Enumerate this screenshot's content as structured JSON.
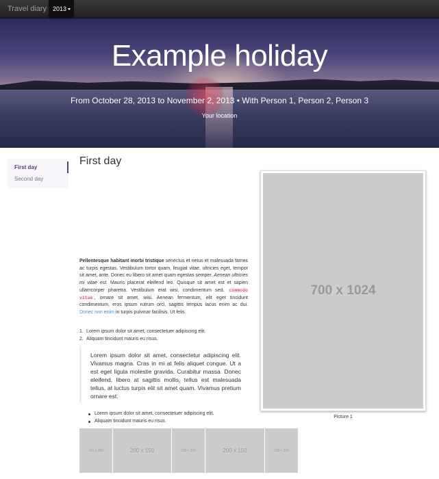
{
  "navbar": {
    "brand": "Travel diary",
    "year": "2013"
  },
  "hero": {
    "title": "Example holiday",
    "dates": "From October 28, 2013 to November 2, 2013 • With Person 1, Person 2, Person 3",
    "location": "Your location"
  },
  "sidebar": {
    "items": [
      {
        "label": "First day",
        "active": true
      },
      {
        "label": "Second day",
        "active": false
      }
    ]
  },
  "main": {
    "day_title": "First day",
    "big_picture": {
      "placeholder": "700 x 1024",
      "caption": "Picture 1"
    },
    "lead": {
      "bold": "Pellentesque habitant morbi tristique",
      "text1": " senectus et netus et malesuada fames ac turpis egestas. Vestibulum tortor quam, feugiat vitae, ultricies eget, tempor sit amet, ante. Donec eu libero sit amet quam egestas semper. ",
      "italic": "Aenean ultricies mi vitae est.",
      "text2": " Mauris placerat eleifend leo. Quisque sit amet est et sapien ullamcorper pharetra. Vestibulum erat wisi, condimentum sed, ",
      "code": "commodo vitae",
      "text3": ", ornare sit amet, wisi. Aenean fermentum, elit eget tincidunt condimentum, eros ipsum rutrum orci, sagittis tempus lacus enim ac dui. ",
      "link": "Donec non enim",
      "text4": " in turpis pulvinar facilisis. Ut felis."
    },
    "ordered_list": [
      {
        "num": "1.",
        "text": "Lorem ipsum dolor sit amet, consectetuer adipiscing elit."
      },
      {
        "num": "2.",
        "text": "Aliquam tincidunt mauris eu risus."
      }
    ],
    "blockquote": "Lorem ipsum dolor sit amet, consectetur adipiscing elit. Vivamus magna. Cras in mi at felis aliquet congue. Ut a est eget ligula molestie gravida. Curabitur massa. Donec eleifend, libero at sagittis mollis, tellus est malesuada tellus, at luctus turpis elit sit amet quam. Vivamus pretium ornare est.",
    "unordered_list": [
      "Lorem ipsum dolor sit amet, consectetuer adipiscing elit.",
      "Aliquam tincidunt mauris eu risus."
    ],
    "gallery": [
      {
        "label": "150 x 200"
      },
      {
        "label": "200 x 150"
      },
      {
        "label": "150 x 200"
      },
      {
        "label": "200 x 150"
      },
      {
        "label": "150 x 200"
      }
    ]
  },
  "colors": {
    "accent": "#563d7c",
    "link": "#428bca",
    "code": "#c7254e",
    "placeholder": "#cccccc"
  }
}
